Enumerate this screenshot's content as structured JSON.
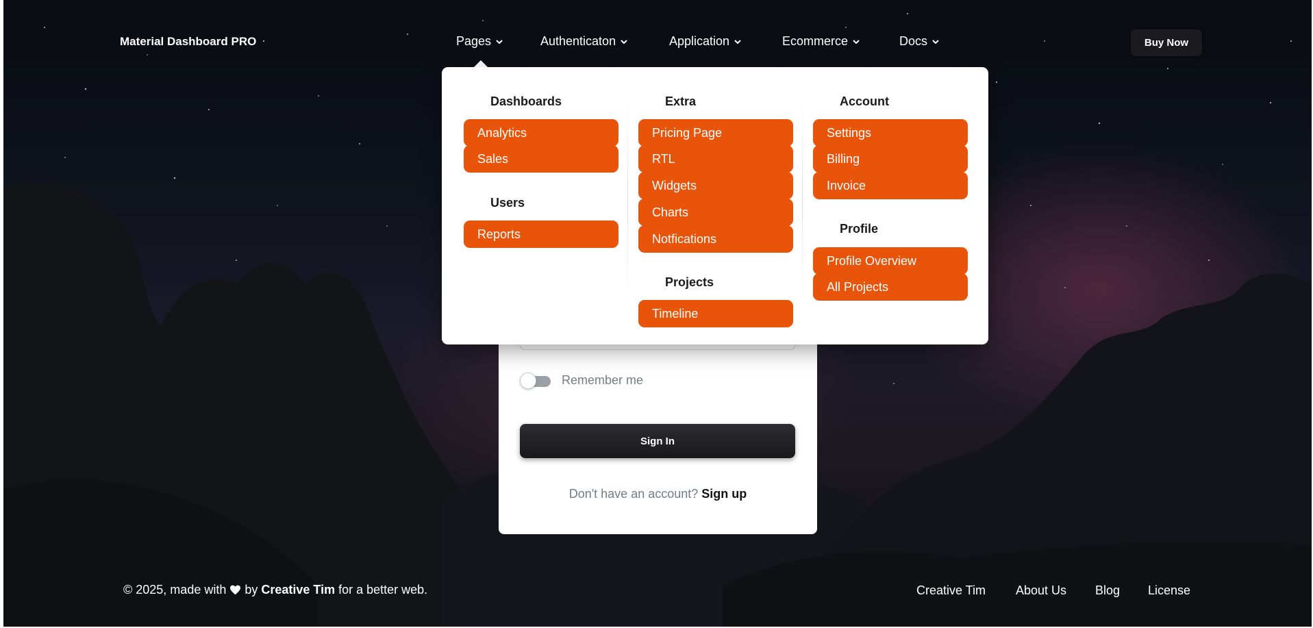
{
  "navbar": {
    "brand": "Material Dashboard PRO",
    "items": [
      {
        "label": "Pages"
      },
      {
        "label": "Authenticaton"
      },
      {
        "label": "Application"
      },
      {
        "label": "Ecommerce"
      },
      {
        "label": "Docs"
      }
    ],
    "buy_now": "Buy Now"
  },
  "dropdown": {
    "columns": [
      {
        "sections": [
          {
            "title": "Dashboards",
            "items": [
              "Analytics",
              "Sales"
            ]
          },
          {
            "title": "Users",
            "items": [
              "Reports"
            ]
          }
        ]
      },
      {
        "sections": [
          {
            "title": "Extra",
            "items": [
              "Pricing Page",
              "RTL",
              "Widgets",
              "Charts",
              "Notfications"
            ]
          },
          {
            "title": "Projects",
            "items": [
              "Timeline"
            ]
          }
        ]
      },
      {
        "sections": [
          {
            "title": "Account",
            "items": [
              "Settings",
              "Billing",
              "Invoice"
            ]
          },
          {
            "title": "Profile",
            "items": [
              "Profile Overview",
              "All Projects"
            ]
          }
        ]
      }
    ]
  },
  "login": {
    "remember_label": "Remember me",
    "remember_checked": false,
    "signin_label": "Sign In",
    "signup_prompt": "Don't have an account?",
    "signup_link": "Sign up"
  },
  "footer": {
    "copyright": "© 2025, made with",
    "by": "by",
    "author": "Creative Tim",
    "suffix": "for a better web.",
    "links": [
      "Creative Tim",
      "About Us",
      "Blog",
      "License"
    ]
  },
  "colors": {
    "accent": "#e8540a",
    "dark_button": "#1b1b1f"
  }
}
